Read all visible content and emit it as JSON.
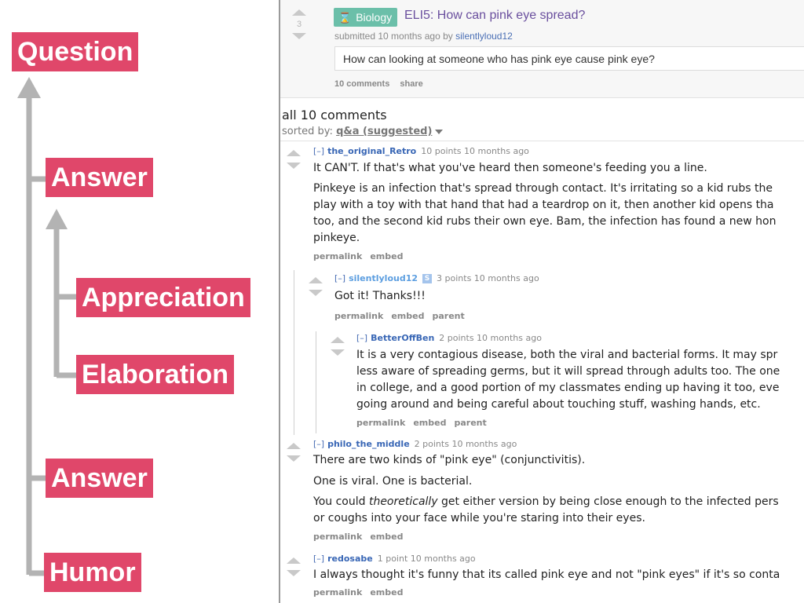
{
  "labels": {
    "question": "Question",
    "answer_1": "Answer",
    "appreciation": "Appreciation",
    "elaboration": "Elaboration",
    "answer_2": "Answer",
    "humor": "Humor"
  },
  "colors": {
    "label_bg": "#e0476a",
    "arrow": "#b3b3b3",
    "flair_bg": "#6bbfa9",
    "title": "#6a4f9e",
    "author": "#3866b5"
  },
  "post": {
    "score": "3",
    "flair_icon": "hourglass-icon",
    "flair": "Biology",
    "title": "ELI5: How can pink eye spread?",
    "submitted_prefix": "submitted 10 months ago by",
    "author": "silentlyloud12",
    "body": "How can looking at someone who has pink eye cause pink eye?",
    "comments_link": "10 comments",
    "share_link": "share"
  },
  "comments_section": {
    "header": "all 10 comments",
    "sorted_by_label": "sorted by:",
    "sort_value": "q&a (suggested)"
  },
  "comments": [
    {
      "toggle": "[–]",
      "author": "the_original_Retro",
      "meta": "10 points 10 months ago",
      "paragraphs": [
        "It CAN'T. If that's what you've heard then someone's feeding you a line.",
        "Pinkeye is an infection that's spread through contact. It's irritating so a kid rubs the",
        "play with a toy with that hand that had a teardrop on it, then another kid opens tha",
        "too, and the second kid rubs their own eye. Bam, the infection has found a new hon",
        "pinkeye."
      ],
      "links": [
        "permalink",
        "embed"
      ]
    },
    {
      "toggle": "[–]",
      "author": "silentlyloud12",
      "badge": "S",
      "meta": "3 points 10 months ago",
      "paragraphs": [
        "Got it! Thanks!!!"
      ],
      "links": [
        "permalink",
        "embed",
        "parent"
      ]
    },
    {
      "toggle": "[–]",
      "author": "BetterOffBen",
      "meta": "2 points 10 months ago",
      "paragraphs": [
        "It is a very contagious disease, both the viral and bacterial forms. It may spr",
        "less aware of spreading germs, but it will spread through adults too. The one",
        "in college, and a good portion of my classmates ending up having it too, eve",
        "going around and being careful about touching stuff, washing hands, etc."
      ],
      "links": [
        "permalink",
        "embed",
        "parent"
      ]
    },
    {
      "toggle": "[–]",
      "author": "philo_the_middle",
      "meta": "2 points 10 months ago",
      "paragraphs": [
        "There are two kinds of \"pink eye\" (conjunctivitis).",
        "One is viral. One is bacterial.",
        "get either version by being close enough to the infected pers",
        "or coughs into your face while you're staring into their eyes."
      ],
      "italic_prefix": "You could ",
      "italic_word": "theoretically",
      "links": [
        "permalink",
        "embed"
      ]
    },
    {
      "toggle": "[–]",
      "author": "redosabe",
      "meta": "1 point 10 months ago",
      "paragraphs": [
        "I always thought it's funny that its called pink eye and not \"pink eyes\" if it's so conta"
      ],
      "links": [
        "permalink",
        "embed"
      ]
    }
  ]
}
